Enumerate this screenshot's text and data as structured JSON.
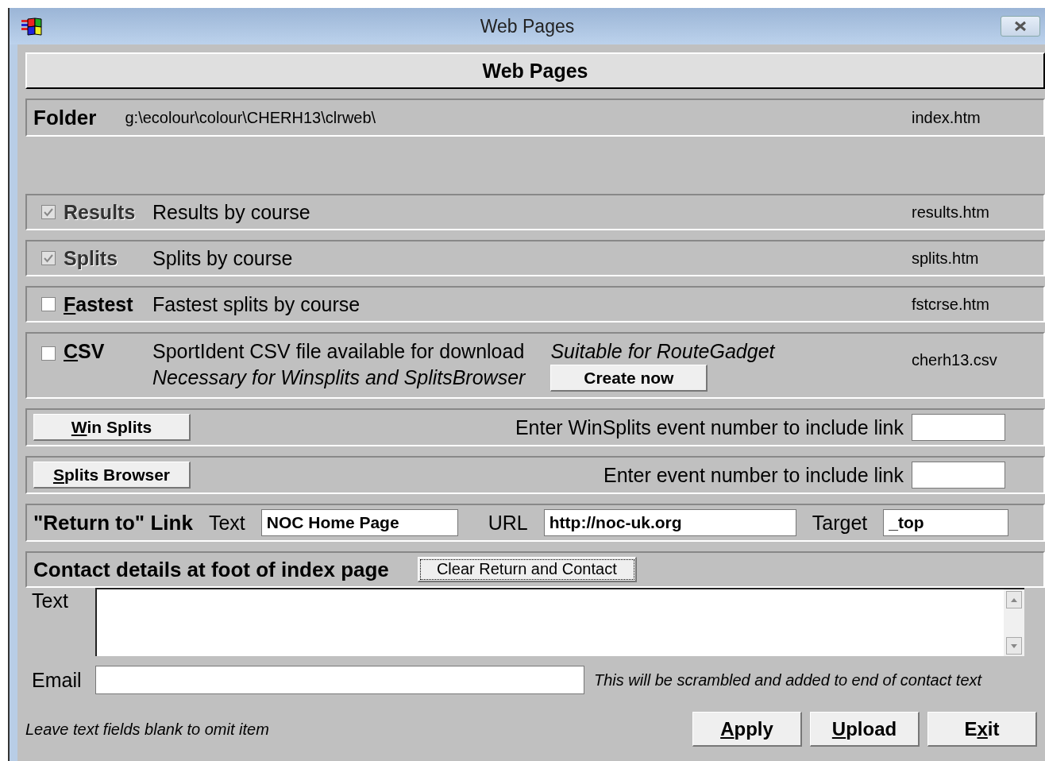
{
  "window": {
    "title": "Web Pages"
  },
  "heading": "Web Pages",
  "folder": {
    "label": "Folder",
    "path": "g:\\ecolour\\colour\\CHERH13\\clrweb\\",
    "file": "index.htm"
  },
  "pages": [
    {
      "label_start": "Results",
      "description": "Results by course",
      "file": "results.htm",
      "checked": true,
      "disabled": true
    },
    {
      "label_start": "Splits",
      "description": "Splits by course",
      "file": "splits.htm",
      "checked": true,
      "disabled": true
    },
    {
      "access_key": "F",
      "label_end": "astest",
      "description": "Fastest splits by course",
      "file": "fstcrse.htm",
      "checked": false,
      "disabled": false
    }
  ],
  "csv": {
    "access_key": "C",
    "label_end": "SV",
    "checked": false,
    "description": "SportIdent CSV file available for download",
    "note": "Necessary for Winsplits and SplitsBrowser",
    "suitable": "Suitable for RouteGadget",
    "button": "Create now",
    "file": "cherh13.csv"
  },
  "links": [
    {
      "access_key": "W",
      "label_end": "in Splits",
      "prompt": "Enter WinSplits event number to include link"
    },
    {
      "access_key": "S",
      "label_end": "plits Browser",
      "prompt": "Enter event number to include link"
    }
  ],
  "return_link": {
    "label": "\"Return to\" Link",
    "text_label": "Text",
    "text_value": "NOC Home Page",
    "url_label": "URL",
    "url_value": "http://noc-uk.org",
    "target_label": "Target",
    "target_value": "_top"
  },
  "contact": {
    "label": "Contact details at foot of index page",
    "clear_button": "Clear Return and Contact",
    "text_label": "Text",
    "email_label": "Email",
    "email_note": "This will be scrambled and added to end of contact text"
  },
  "footer_note": "Leave text fields blank to omit item",
  "buttons": [
    {
      "access_key": "A",
      "label_end": "pply"
    },
    {
      "access_key": "U",
      "label_end": "pload"
    },
    {
      "label_start": "E",
      "access_key": "x",
      "label_end": "it"
    }
  ]
}
